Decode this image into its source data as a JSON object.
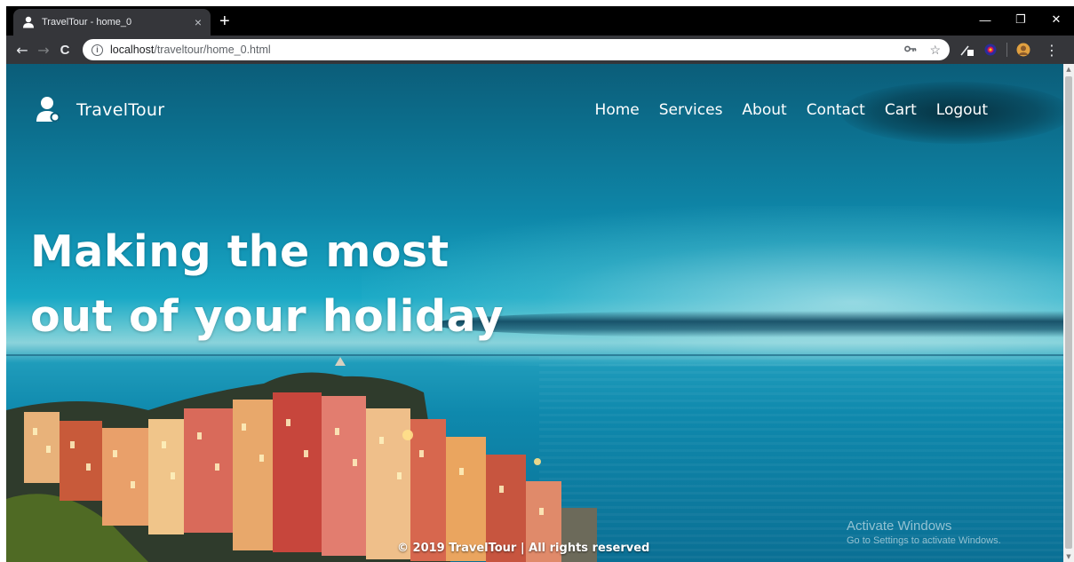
{
  "browser": {
    "tab_title": "TravelTour - home_0",
    "tab_close": "×",
    "new_tab": "+",
    "window_controls": {
      "minimize": "—",
      "restore": "❐",
      "close": "✕"
    },
    "back": "←",
    "forward": "→",
    "reload": "C",
    "url_host": "localhost",
    "url_path": "/traveltour/home_0.html",
    "menu": "⋮"
  },
  "site": {
    "brand": "TravelTour",
    "nav": [
      "Home",
      "Services",
      "About",
      "Contact",
      "Cart",
      "Logout"
    ],
    "hero_line1": "Making the most",
    "hero_line2": "out of your holiday",
    "footer": "© 2019 TravelTour | All rights reserved"
  },
  "os_watermark": {
    "title": "Activate Windows",
    "subtitle": "Go to Settings to activate Windows."
  },
  "colors": {
    "tab_bar": "#000000",
    "toolbar": "#35363a",
    "sky": "#0e86a8",
    "sea": "#0a6f94"
  },
  "icons": {
    "tab_favicon": "user-icon",
    "site_logo": "user-icon",
    "omnibox_left": "info-icon",
    "omnibox_key": "key-icon",
    "omnibox_star": "star-icon"
  }
}
